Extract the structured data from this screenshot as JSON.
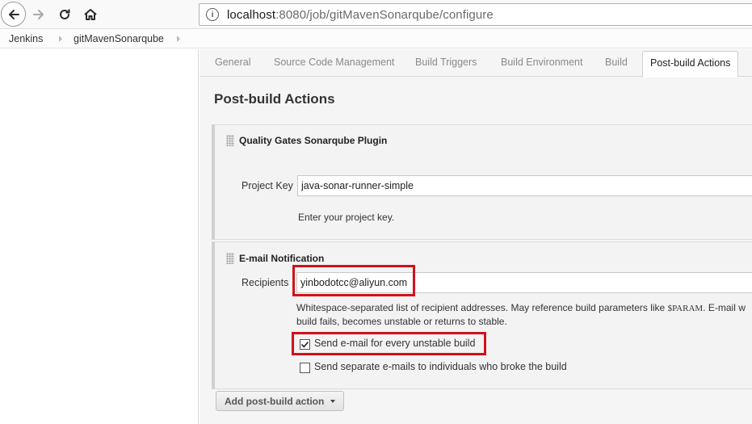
{
  "browser": {
    "url_host": "localhost",
    "url_path": ":8080/job/gitMavenSonarqube/configure"
  },
  "breadcrumb": [
    "Jenkins",
    "gitMavenSonarqube"
  ],
  "tabs": [
    {
      "label": "General",
      "active": false
    },
    {
      "label": "Source Code Management",
      "active": false
    },
    {
      "label": "Build Triggers",
      "active": false
    },
    {
      "label": "Build Environment",
      "active": false
    },
    {
      "label": "Build",
      "active": false
    },
    {
      "label": "Post-build Actions",
      "active": true
    }
  ],
  "section_title": "Post-build Actions",
  "quality_gates": {
    "title": "Quality Gates Sonarqube Plugin",
    "project_key_label": "Project Key",
    "project_key_value": "java-sonar-runner-simple",
    "project_key_help": "Enter your project key."
  },
  "email": {
    "title": "E-mail Notification",
    "recipients_label": "Recipients",
    "recipients_value": "yinbodotcc@aliyun.com",
    "help_pre": "Whitespace-separated list of recipient addresses. May reference build parameters like ",
    "help_param": "$PARAM",
    "help_post": ". E-mail w",
    "help_line2": "build fails, becomes unstable or returns to stable.",
    "unstable_label": "Send e-mail for every unstable build",
    "unstable_checked": true,
    "separate_label": "Send separate e-mails to individuals who broke the build",
    "separate_checked": false
  },
  "add_action_label": "Add post-build action",
  "colors": {
    "highlight": "#d0121b",
    "panel_bg": "#f3f3f3",
    "main_bg": "#f5f5f5"
  }
}
